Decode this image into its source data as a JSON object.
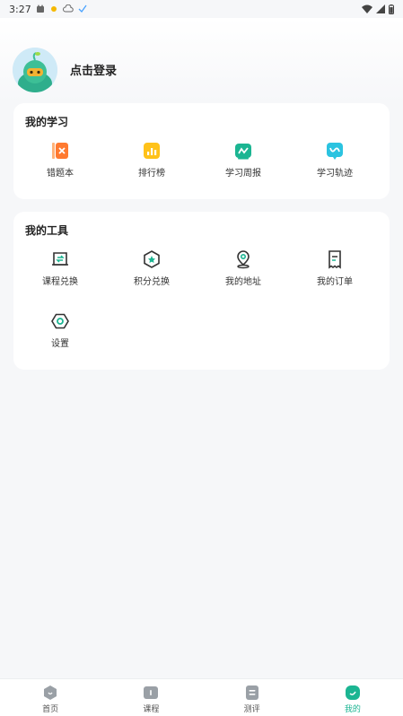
{
  "status_bar": {
    "time": "3:27"
  },
  "profile": {
    "login_label": "点击登录"
  },
  "my_study": {
    "title": "我的学习",
    "items": [
      {
        "label": "错题本",
        "icon": "wrong-questions-icon",
        "color": "#ff7a30"
      },
      {
        "label": "排行榜",
        "icon": "ranking-icon",
        "color": "#ffc21a"
      },
      {
        "label": "学习周报",
        "icon": "weekly-report-icon",
        "color": "#1bb592"
      },
      {
        "label": "学习轨迹",
        "icon": "learning-track-icon",
        "color": "#2bc3e0"
      }
    ]
  },
  "my_tools": {
    "title": "我的工具",
    "items": [
      {
        "label": "课程兑换",
        "icon": "course-exchange-icon"
      },
      {
        "label": "积分兑换",
        "icon": "points-exchange-icon"
      },
      {
        "label": "我的地址",
        "icon": "address-icon"
      },
      {
        "label": "我的订单",
        "icon": "orders-icon"
      },
      {
        "label": "设置",
        "icon": "settings-icon"
      }
    ]
  },
  "tabbar": {
    "tabs": [
      {
        "label": "首页",
        "icon": "home-icon",
        "active": false
      },
      {
        "label": "课程",
        "icon": "course-icon",
        "active": false
      },
      {
        "label": "测评",
        "icon": "assessment-icon",
        "active": false
      },
      {
        "label": "我的",
        "icon": "profile-icon",
        "active": true
      }
    ],
    "active_color": "#1bb592",
    "inactive_color": "#9aa0a6"
  }
}
